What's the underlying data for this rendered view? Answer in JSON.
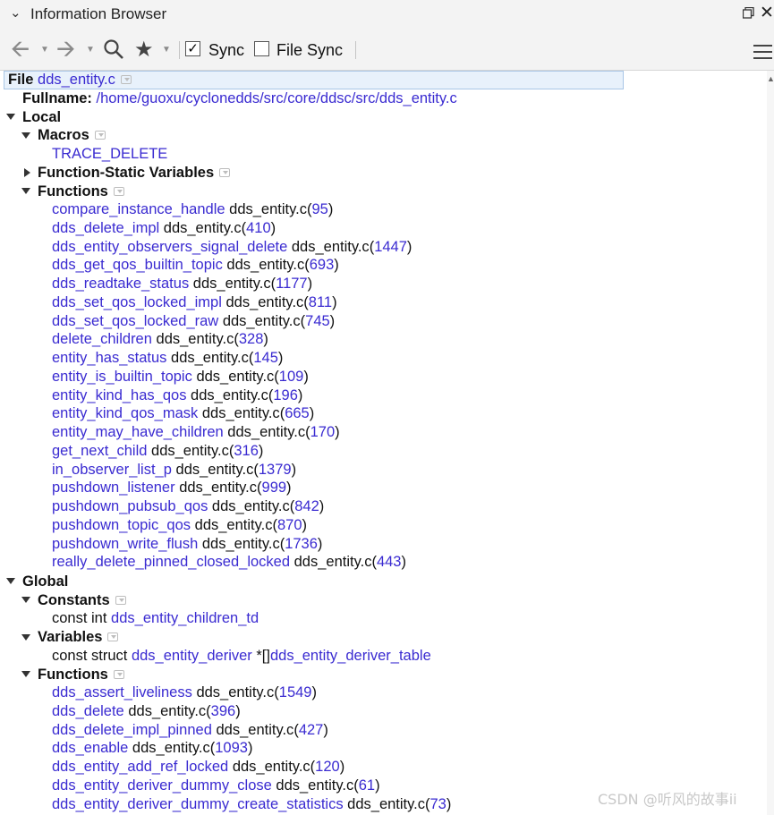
{
  "window": {
    "title": "Information Browser"
  },
  "toolbar": {
    "sync_label": "Sync",
    "sync_checked": true,
    "file_sync_label": "File Sync",
    "file_sync_checked": false
  },
  "file": {
    "label": "File",
    "name": "dds_entity.c",
    "fullname_label": "Fullname:",
    "fullname": "/home/guoxu/cyclonedds/src/core/ddsc/src/dds_entity.c"
  },
  "local": {
    "label": "Local",
    "macros": {
      "label": "Macros",
      "items": [
        "TRACE_DELETE"
      ]
    },
    "function_static": {
      "label": "Function-Static Variables"
    },
    "functions": {
      "label": "Functions",
      "items": [
        {
          "name": "compare_instance_handle",
          "file": "dds_entity.c",
          "line": "95"
        },
        {
          "name": "dds_delete_impl",
          "file": "dds_entity.c",
          "line": "410"
        },
        {
          "name": "dds_entity_observers_signal_delete",
          "file": "dds_entity.c",
          "line": "1447"
        },
        {
          "name": "dds_get_qos_builtin_topic",
          "file": "dds_entity.c",
          "line": "693"
        },
        {
          "name": "dds_readtake_status",
          "file": "dds_entity.c",
          "line": "1177"
        },
        {
          "name": "dds_set_qos_locked_impl",
          "file": "dds_entity.c",
          "line": "811"
        },
        {
          "name": "dds_set_qos_locked_raw",
          "file": "dds_entity.c",
          "line": "745"
        },
        {
          "name": "delete_children",
          "file": "dds_entity.c",
          "line": "328"
        },
        {
          "name": "entity_has_status",
          "file": "dds_entity.c",
          "line": "145"
        },
        {
          "name": "entity_is_builtin_topic",
          "file": "dds_entity.c",
          "line": "109"
        },
        {
          "name": "entity_kind_has_qos",
          "file": "dds_entity.c",
          "line": "196"
        },
        {
          "name": "entity_kind_qos_mask",
          "file": "dds_entity.c",
          "line": "665"
        },
        {
          "name": "entity_may_have_children",
          "file": "dds_entity.c",
          "line": "170"
        },
        {
          "name": "get_next_child",
          "file": "dds_entity.c",
          "line": "316"
        },
        {
          "name": "in_observer_list_p",
          "file": "dds_entity.c",
          "line": "1379"
        },
        {
          "name": "pushdown_listener",
          "file": "dds_entity.c",
          "line": "999"
        },
        {
          "name": "pushdown_pubsub_qos",
          "file": "dds_entity.c",
          "line": "842"
        },
        {
          "name": "pushdown_topic_qos",
          "file": "dds_entity.c",
          "line": "870"
        },
        {
          "name": "pushdown_write_flush",
          "file": "dds_entity.c",
          "line": "1736"
        },
        {
          "name": "really_delete_pinned_closed_locked",
          "file": "dds_entity.c",
          "line": "443"
        }
      ]
    }
  },
  "global": {
    "label": "Global",
    "constants": {
      "label": "Constants",
      "items": [
        {
          "prefix": "const int ",
          "name": "dds_entity_children_td"
        }
      ]
    },
    "variables": {
      "label": "Variables",
      "items": [
        {
          "prefix": "const struct ",
          "type": "dds_entity_deriver",
          "mid": " *[]",
          "name": "dds_entity_deriver_table"
        }
      ]
    },
    "functions": {
      "label": "Functions",
      "items": [
        {
          "name": "dds_assert_liveliness",
          "file": "dds_entity.c",
          "line": "1549"
        },
        {
          "name": "dds_delete",
          "file": "dds_entity.c",
          "line": "396"
        },
        {
          "name": "dds_delete_impl_pinned",
          "file": "dds_entity.c",
          "line": "427"
        },
        {
          "name": "dds_enable",
          "file": "dds_entity.c",
          "line": "1093"
        },
        {
          "name": "dds_entity_add_ref_locked",
          "file": "dds_entity.c",
          "line": "120"
        },
        {
          "name": "dds_entity_deriver_dummy_close",
          "file": "dds_entity.c",
          "line": "61"
        },
        {
          "name": "dds_entity_deriver_dummy_create_statistics",
          "file": "dds_entity.c",
          "line": "73"
        }
      ]
    }
  },
  "watermark": "CSDN @听风的故事ii"
}
